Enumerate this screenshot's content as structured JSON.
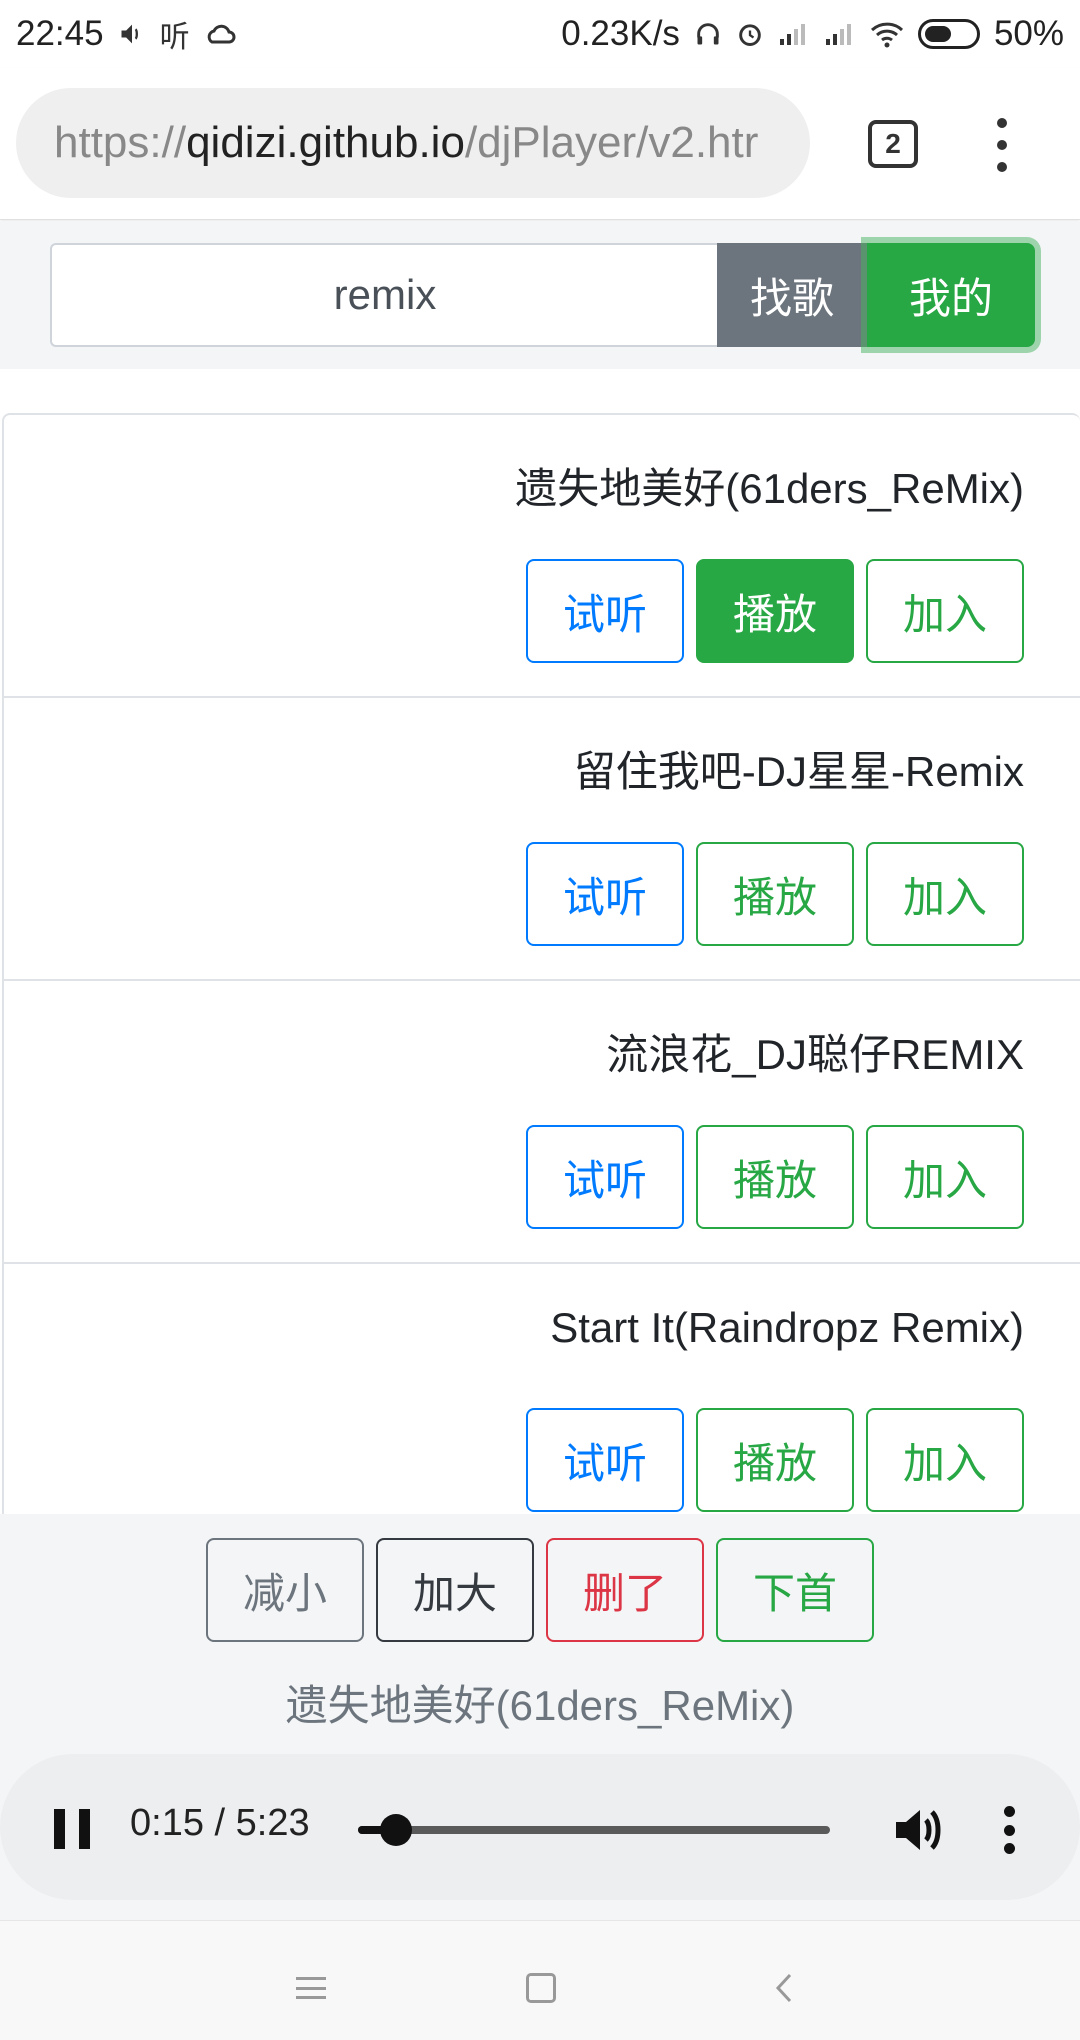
{
  "status_bar": {
    "time": "22:45",
    "speed": "0.23K/s",
    "battery": "50%",
    "icons": [
      "volume-icon",
      "listen-app-icon",
      "cloud-icon",
      "headset-icon",
      "alarm-icon",
      "signal-icon",
      "signal-icon",
      "wifi-icon",
      "battery-icon"
    ],
    "listen_glyph": "听"
  },
  "browser": {
    "url_scheme": "https://",
    "url_host": "qidizi.github.io",
    "url_path": "/djPlayer/v2.htr",
    "tab_count": "2"
  },
  "search": {
    "query": "remix",
    "find_label": "找歌",
    "mine_label": "我的"
  },
  "songs": [
    {
      "title": "遗失地美好(61ders_ReMix)",
      "preview": "试听",
      "play": "播放",
      "add": "加入",
      "active": true
    },
    {
      "title": "留住我吧-DJ星星-Remix",
      "preview": "试听",
      "play": "播放",
      "add": "加入",
      "active": false
    },
    {
      "title": "流浪花_DJ聪仔REMIX",
      "preview": "试听",
      "play": "播放",
      "add": "加入",
      "active": false
    },
    {
      "title": "Start It(Raindropz Remix)",
      "preview": "试听",
      "play": "播放",
      "add": "加入",
      "active": false
    }
  ],
  "player": {
    "decrease": "减小",
    "increase": "加大",
    "delete": "删了",
    "next": "下首",
    "now_playing": "遗失地美好(61ders_ReMix)",
    "time_display": "0:15 / 5:23",
    "progress_fraction": 0.08
  },
  "colors": {
    "primary": "#007bff",
    "success": "#28a745",
    "secondary": "#6c757d",
    "danger": "#dc3545",
    "dark": "#343a40"
  }
}
